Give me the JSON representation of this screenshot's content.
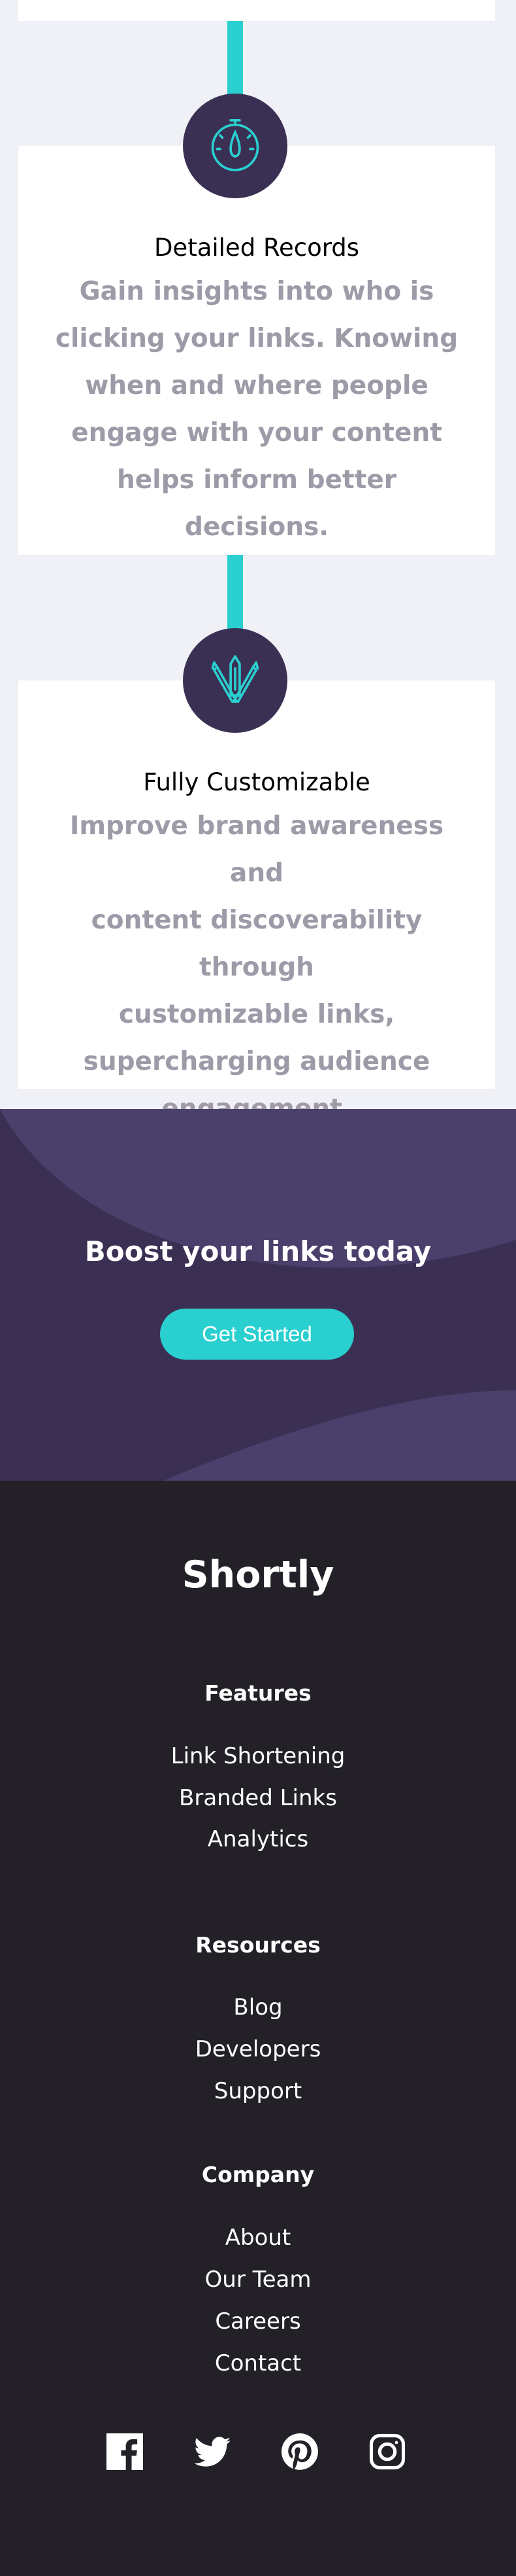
{
  "features": [
    {
      "title": "Detailed Records",
      "icon": "gauge-icon",
      "lines": [
        "Gain insights into who is",
        "clicking your links. Knowing",
        "when and where people",
        "engage with your content",
        "helps inform better decisions."
      ]
    },
    {
      "title": "Fully Customizable",
      "icon": "pens-icon",
      "lines": [
        "Improve brand awareness and",
        "content discoverability through",
        "customizable links,",
        "supercharging audience",
        "engagement."
      ]
    }
  ],
  "boost": {
    "title": "Boost your links today",
    "button": "Get Started"
  },
  "footer": {
    "brand": "Shortly",
    "columns": [
      {
        "heading": "Features",
        "links": [
          "Link Shortening",
          "Branded Links",
          "Analytics"
        ]
      },
      {
        "heading": "Resources",
        "links": [
          "Blog",
          "Developers",
          "Support"
        ]
      },
      {
        "heading": "Company",
        "links": [
          "About",
          "Our Team",
          "Careers",
          "Contact"
        ]
      }
    ],
    "social": [
      "facebook-icon",
      "twitter-icon",
      "pinterest-icon",
      "instagram-icon"
    ]
  },
  "colors": {
    "accent": "#2acfcf",
    "dark_violet": "#3b3054",
    "footer_bg": "#232127",
    "gray_text": "#9e9aa7"
  }
}
